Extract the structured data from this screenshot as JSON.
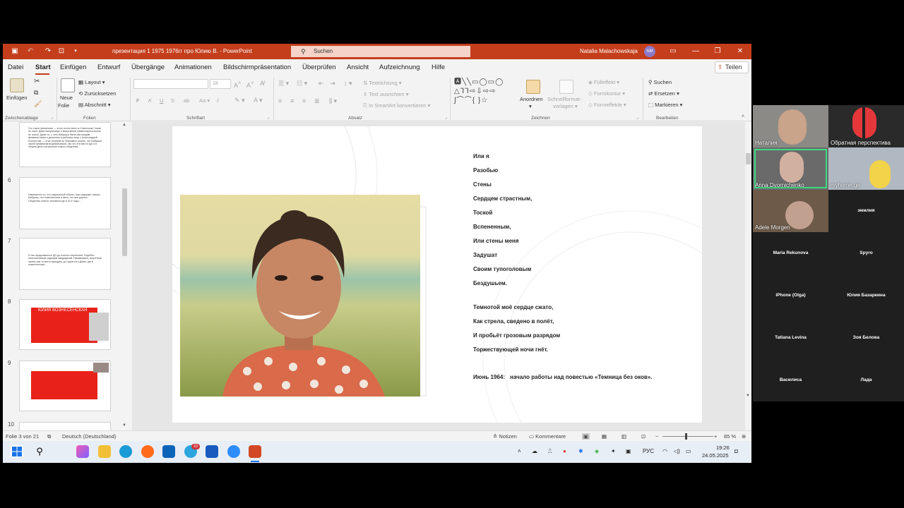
{
  "app": {
    "doc_title": "презентация 1 1975 1976гг про Юлию В.",
    "app_name": "PowerPoint",
    "title_sep": " - ",
    "search_placeholder": "Suchen",
    "user_name": "Natalia Malachowskaja",
    "user_initials": "NM"
  },
  "tabs": [
    "Datei",
    "Start",
    "Einfügen",
    "Entwurf",
    "Übergänge",
    "Animationen",
    "Bildschirmpräsentation",
    "Überprüfen",
    "Ansicht",
    "Aufzeichnung",
    "Hilfe"
  ],
  "active_tab": "Start",
  "share_label": "Teilen",
  "ribbon": {
    "clipboard": {
      "paste": "Einfügen",
      "group": "Zwischenablage"
    },
    "slides": {
      "new_slide_1": "Neue",
      "new_slide_2": "Folie",
      "layout": "Layout",
      "reset": "Zurücksetzen",
      "section": "Abschnitt",
      "group": "Folien"
    },
    "font": {
      "size": "18",
      "group": "Schriftart",
      "bold": "F",
      "italic": "K",
      "underline": "U",
      "strike": "S"
    },
    "paragraph": {
      "text_direction": "Textrichtung",
      "align_text": "Text ausrichten",
      "smartart": "In SmartArt konvertieren",
      "group": "Absatz"
    },
    "drawing": {
      "arrange_1": "Anordnen",
      "quick_styles_1": "Schnellformat-",
      "quick_styles_2": "vorlagen",
      "fill": "Fülleffekt",
      "outline": "Formkontur",
      "effects": "Formeffekte",
      "group": "Zeichnen"
    },
    "editing": {
      "find": "Suchen",
      "replace": "Ersetzen",
      "select": "Markieren",
      "group": "Bearbeiten"
    }
  },
  "thumbnails": [
    {
      "num": "",
      "text": "Что такое феминизм — этого почти никто в Советском Союзе не знал. Даже выпускницы и выпускники гуманитарных вузов не знали. Даже то, с чего Бабушка была настоящим феминистским и деятелем в рабочем лице с Александрой Коллонтай, — этих понятий не Знакомых Алины, что Бабушки своей феминизм вырабатывала, так что эти места где и в общем деле построения нового общества..."
    },
    {
      "num": "6",
      "text": "Начинается то, что сакральный объект, чем содержит наших Бабушек, пот повелителем и мать, что все дороги... Общество нового человека где в 20-е годы..."
    },
    {
      "num": "7",
      "text": "И так продолжалось ДО до полного перелома. Подобно неисчислимым сидящим кандидатам. Начавшаяся, встретили зачем, как-то всего выходим, до годов того Дома, где в значительную..."
    },
    {
      "num": "8",
      "title": "ЮЛИЯ ВОЗНЕСЕНСКАЯ"
    },
    {
      "num": "9"
    },
    {
      "num": "10"
    }
  ],
  "poem": {
    "stanza1": [
      "Или я",
      "Разобью",
      "Стены",
      "Сердцем страстным,",
      "Тоской",
      "Вспененным,",
      "Или стены меня",
      "Задушат",
      "Своим тупоголовым",
      "Бездушьем."
    ],
    "stanza2": [
      "Темнотой моё сердце сжато,",
      "Как стрела, сведено в полёт,",
      "И пробьёт грозовым разрядом",
      "Торжествующей ночи гнёт."
    ],
    "note_date": "Июнь 1964:",
    "note_text": "начало работы над повестью «Темница без оков»."
  },
  "status": {
    "slide_info": "Folie 3 von 21",
    "language": "Deutsch (Deutschland)",
    "notes": "Notizen",
    "comments": "Kommentare",
    "zoom": "85 %",
    "zoom_fraction": 0.45
  },
  "taskbar": {
    "badge_count": "10",
    "lang": "РУС",
    "time": "19:26",
    "date": "24.05.2025"
  },
  "participants": {
    "video": [
      "Наталия",
      "Обратная перспектива",
      "Anna Dvornichenko",
      "myhome.ge",
      "Adele Morgen"
    ],
    "names": [
      "эмилия",
      "Maria Rekunova",
      "Spyro",
      "iPhone (Olga)",
      "Юлия Базаркина",
      "Tatiana Levina",
      "Зоя Белова",
      "Василиса",
      "Лада"
    ]
  },
  "colors": {
    "accent": "#c43e1c",
    "slide_red": "#e8221a",
    "zoom_bg": "#1f1f1f"
  }
}
